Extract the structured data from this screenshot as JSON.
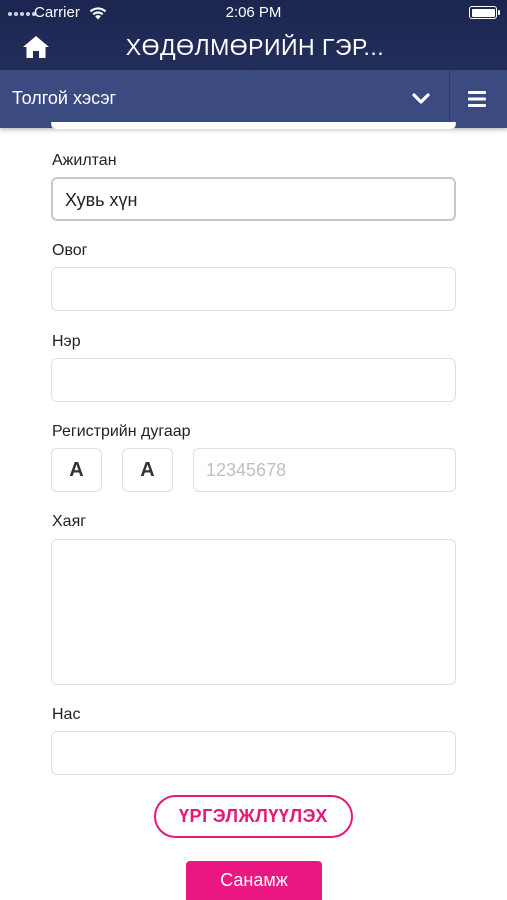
{
  "status_bar": {
    "carrier": "Carrier",
    "time": "2:06 PM",
    "battery_level": 1.0
  },
  "header": {
    "title": "ХӨДӨЛМӨРИЙН ГЭР...",
    "home_icon": "home-icon"
  },
  "section": {
    "label": "Толгой хэсэг",
    "chevron_icon": "chevron-down-icon",
    "menu_icon": "hamburger-menu-icon"
  },
  "form": {
    "employee": {
      "label": "Ажилтан",
      "value": "Хувь хүн"
    },
    "surname": {
      "label": "Овог",
      "value": ""
    },
    "name": {
      "label": "Нэр",
      "value": ""
    },
    "register": {
      "label": "Регистрийн дугаар",
      "letter1": "А",
      "letter2": "А",
      "placeholder": "12345678"
    },
    "address": {
      "label": "Хаяг",
      "value": ""
    },
    "age": {
      "label": "Нас",
      "value": ""
    }
  },
  "actions": {
    "continue_label": "ҮРГЭЛЖЛҮҮЛЭХ",
    "hint_label": "Санамж"
  },
  "colors": {
    "header_bg": "#1d2850",
    "section_bg": "#3c4a82",
    "accent": "#e6197a"
  }
}
